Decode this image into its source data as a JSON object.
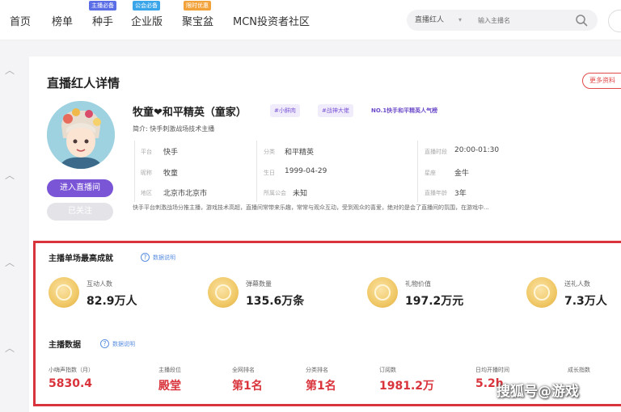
{
  "nav": {
    "items": [
      "首页",
      "榜单",
      "种手",
      "企业版",
      "聚宝盆",
      "MCN投资者社区"
    ],
    "tags": [
      {
        "text": "主播必备",
        "color": "#5b6ee6"
      },
      {
        "text": "公会必备",
        "color": "#3aa5e8"
      },
      {
        "text": "限时优惠",
        "color": "#f2a23a"
      }
    ]
  },
  "search": {
    "selected": "直播红人",
    "placeholder": "输入主播名"
  },
  "page": {
    "title": "直播红人详情",
    "more_button": "更多资料"
  },
  "profile": {
    "name": "牧童❤和平精英（童家）",
    "tags": [
      "#小鲜肉",
      "#战神大佬"
    ],
    "rank_badge": "NO.1快手和平精英人气榜",
    "subtitle": "简介: 快手刺激战场技术主播",
    "live_button": "进入直播间",
    "follow_button": "已关注",
    "info": [
      {
        "label": "平台",
        "value": "快手"
      },
      {
        "label": "分类",
        "value": "和平精英"
      },
      {
        "label": "直播时段",
        "value": "20:00-01:30"
      },
      {
        "label": "昵称",
        "value": "牧童"
      },
      {
        "label": "生日",
        "value": "1999-04-29"
      },
      {
        "label": "星座",
        "value": "金牛"
      },
      {
        "label": "地区",
        "value": "北京市北京市"
      },
      {
        "label": "所属公会",
        "value": "未知"
      },
      {
        "label": "直播年龄",
        "value": "3年"
      }
    ],
    "description": "快手平台刺激战场分推主播，游戏技术高超，直播间常带来乐趣，常常与观众互动，受到观众的喜爱，绝对的是会了直播间的氛围，在游戏中..."
  },
  "achievements": {
    "title": "主播单场最高成就",
    "help": "数据说明",
    "items": [
      {
        "label": "互动人数",
        "value": "82.9万人"
      },
      {
        "label": "弹幕数量",
        "value": "135.6万条"
      },
      {
        "label": "礼物价值",
        "value": "197.2万元"
      },
      {
        "label": "送礼人数",
        "value": "7.3万人"
      }
    ]
  },
  "anchor_data": {
    "title": "主播数据",
    "help": "数据说明",
    "items": [
      {
        "label": "小嗨声指数（月）",
        "value": "5830.4"
      },
      {
        "label": "主播段位",
        "value": "殿堂"
      },
      {
        "label": "全网排名",
        "value": "第1名"
      },
      {
        "label": "分类排名",
        "value": "第1名"
      },
      {
        "label": "订阅数",
        "value": "1981.2万"
      },
      {
        "label": "日均开播时间",
        "value": "5.2h"
      },
      {
        "label": "成长指数",
        "value": ""
      }
    ]
  },
  "watermark": "搜狐号@游戏"
}
